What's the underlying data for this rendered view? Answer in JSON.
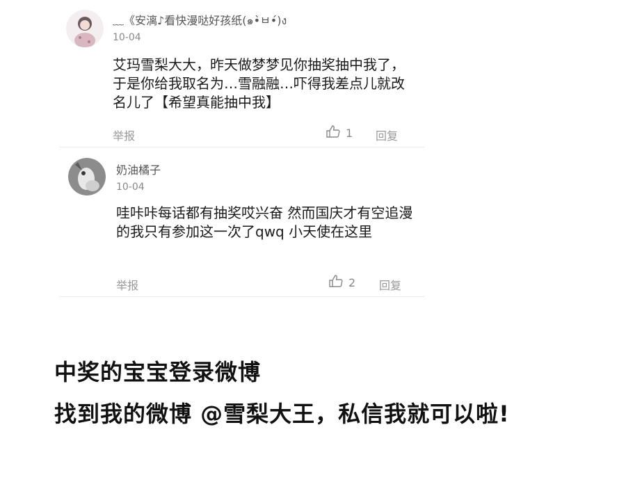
{
  "comments": [
    {
      "username": "﹏《安漓♪看快漫哒好孩纸(๑•̀ㅂ•́)ง",
      "date": "10-04",
      "text": "艾玛雪梨大大，昨天做梦梦见你抽奖抽中我了，于是你给我取名为…雪融融…吓得我差点儿就改名儿了【希望真能抽中我】",
      "report_label": "举报",
      "like_count": "1",
      "reply_label": "回复",
      "like_icon": "thumbs-up-icon"
    },
    {
      "username": "奶油橘子",
      "date": "10-04",
      "text": "哇咔咔每话都有抽奖哎兴奋 然而国庆才有空追漫的我只有参加这一次了qwq  小天使在这里",
      "report_label": "举报",
      "like_count": "2",
      "reply_label": "回复",
      "like_icon": "thumbs-up-icon"
    }
  ],
  "announcement": {
    "line1": "中奖的宝宝登录微博",
    "line2": "找到我的微博 @雪梨大王，私信我就可以啦!"
  },
  "colors": {
    "text": "#1a1a1a",
    "meta": "#888888",
    "divider": "#ececec"
  }
}
